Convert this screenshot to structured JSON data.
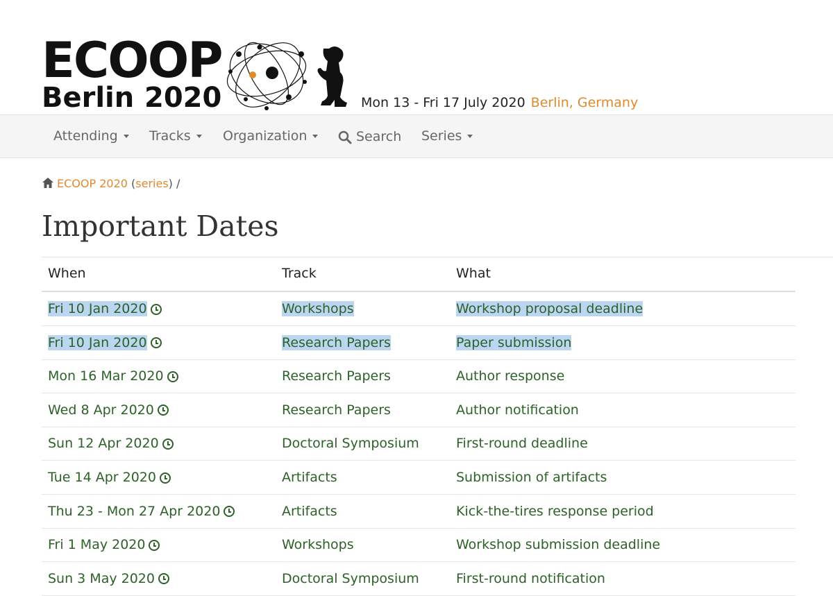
{
  "header": {
    "logo_word": "ECOOP",
    "logo_city": "Berlin",
    "logo_year": "2020",
    "event_dates": "Mon 13 - Fri 17 July 2020",
    "event_location": "Berlin, Germany"
  },
  "nav": {
    "items": [
      {
        "label": "Attending",
        "icon": "caret-down-icon"
      },
      {
        "label": "Tracks",
        "icon": "caret-down-icon"
      },
      {
        "label": "Organization",
        "icon": "caret-down-icon"
      },
      {
        "label": "Search",
        "icon": "search-icon"
      },
      {
        "label": "Series",
        "icon": "caret-down-icon"
      }
    ]
  },
  "breadcrumb": {
    "home_label": "ECOOP 2020",
    "series_open": "(",
    "series_label": "series",
    "series_close": ")",
    "separator": "/"
  },
  "page": {
    "title": "Important Dates"
  },
  "table": {
    "headers": [
      "When",
      "Track",
      "What"
    ],
    "rows": [
      {
        "when": "Fri 10 Jan 2020",
        "track": "Workshops",
        "what": "Workshop proposal deadline",
        "selected": true
      },
      {
        "when": "Fri 10 Jan 2020",
        "track": "Research Papers",
        "what": "Paper submission",
        "selected": true
      },
      {
        "when": "Mon 16 Mar 2020",
        "track": "Research Papers",
        "what": "Author response",
        "selected": false
      },
      {
        "when": "Wed 8 Apr 2020",
        "track": "Research Papers",
        "what": "Author notification",
        "selected": false
      },
      {
        "when": "Sun 12 Apr 2020",
        "track": "Doctoral Symposium",
        "what": "First-round deadline",
        "selected": false
      },
      {
        "when": "Tue 14 Apr 2020",
        "track": "Artifacts",
        "what": "Submission of artifacts",
        "selected": false
      },
      {
        "when": "Thu 23 - Mon 27 Apr 2020",
        "track": "Artifacts",
        "what": "Kick-the-tires response period",
        "selected": false
      },
      {
        "when": "Fri 1 May 2020",
        "track": "Workshops",
        "what": "Workshop submission deadline",
        "selected": false
      },
      {
        "when": "Sun 3 May 2020",
        "track": "Doctoral Symposium",
        "what": "First-round notification",
        "selected": false
      }
    ]
  },
  "colors": {
    "accent_orange": "#e08a2e",
    "date_green": "#2d6128",
    "selection_blue": "#bcd6f2",
    "navbar_bg": "#f5f5f5"
  }
}
